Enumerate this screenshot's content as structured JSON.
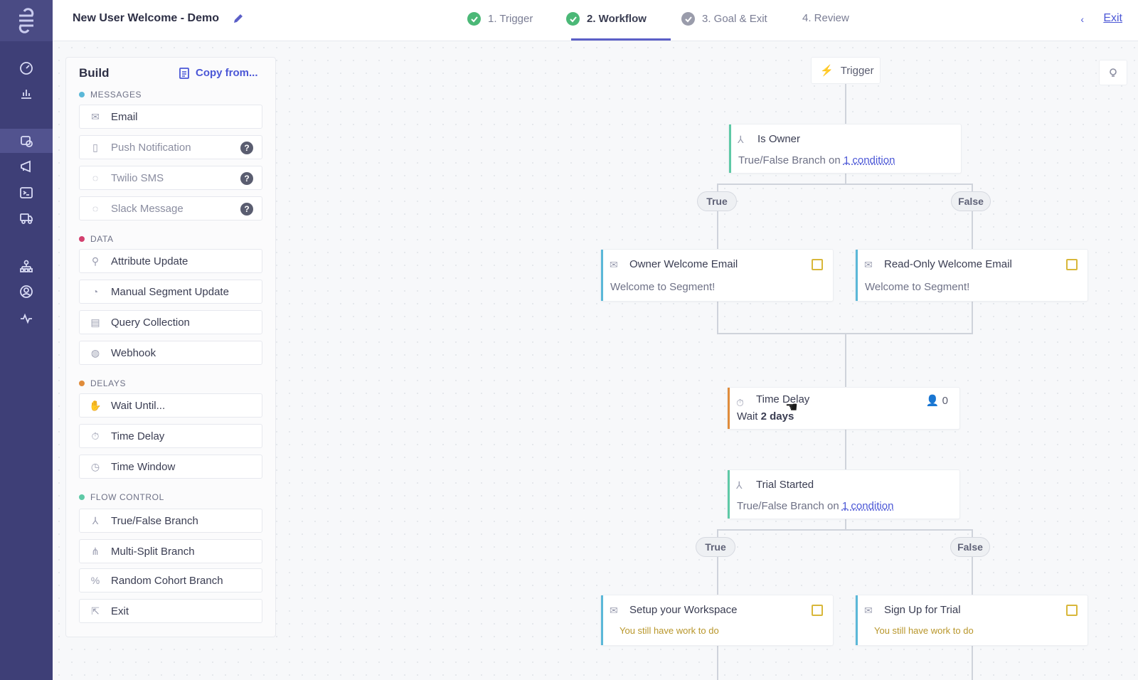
{
  "app": {
    "title": "New User Welcome - Demo",
    "accent_color": "#5b5fc7",
    "rail_color": "#3e3f77"
  },
  "steps": [
    {
      "label": "1. Trigger",
      "status": "done"
    },
    {
      "label": "2. Workflow",
      "status": "active"
    },
    {
      "label": "3. Goal & Exit",
      "status": "done"
    },
    {
      "label": "4. Review",
      "status": "pending"
    }
  ],
  "exit_label": "Exit",
  "build_panel": {
    "title": "Build",
    "copy_from": "Copy from...",
    "sections": {
      "messages": {
        "label": "MESSAGES",
        "color": "#5bb8d8",
        "items": [
          {
            "label": "Email",
            "icon": "envelope-icon"
          },
          {
            "label": "Push Notification",
            "icon": "phone-icon",
            "help": "?"
          },
          {
            "label": "Twilio SMS",
            "icon": "sms-icon",
            "help": "?"
          },
          {
            "label": "Slack Message",
            "icon": "chat-icon",
            "help": "?"
          }
        ]
      },
      "data": {
        "label": "DATA",
        "color": "#d33f6e",
        "items": [
          {
            "label": "Attribute Update",
            "icon": "user-edit-icon"
          },
          {
            "label": "Manual Segment Update",
            "icon": "gauge-icon"
          },
          {
            "label": "Query Collection",
            "icon": "table-icon"
          },
          {
            "label": "Webhook",
            "icon": "globe-icon"
          }
        ]
      },
      "delays": {
        "label": "DELAYS",
        "color": "#e08c3b",
        "items": [
          {
            "label": "Wait Until...",
            "icon": "hand-icon"
          },
          {
            "label": "Time Delay",
            "icon": "stopwatch-icon"
          },
          {
            "label": "Time Window",
            "icon": "clock-icon"
          }
        ]
      },
      "flow_control": {
        "label": "FLOW CONTROL",
        "color": "#5ec9a6",
        "items": [
          {
            "label": "True/False Branch",
            "icon": "branch-icon"
          },
          {
            "label": "Multi-Split Branch",
            "icon": "multi-branch-icon"
          },
          {
            "label": "Random Cohort Branch",
            "icon": "percent-icon"
          },
          {
            "label": "Exit",
            "icon": "exit-icon"
          }
        ]
      }
    }
  },
  "flow": {
    "trigger": "Trigger",
    "is_owner": {
      "title": "Is Owner",
      "sub_prefix": "True/False Branch on",
      "sub_link": "1 condition"
    },
    "branch1_true": "True",
    "branch1_false": "False",
    "owner_email": {
      "title": "Owner Welcome Email",
      "sub": "Welcome to Segment!"
    },
    "readonly_email": {
      "title": "Read-Only Welcome Email",
      "sub": "Welcome to Segment!"
    },
    "time_delay": {
      "title": "Time Delay",
      "sub_prefix": "Wait",
      "sub_value": "2 days",
      "count": "0"
    },
    "trial_started": {
      "title": "Trial Started",
      "sub_prefix": "True/False Branch on",
      "sub_link": "1 condition"
    },
    "branch2_true": "True",
    "branch2_false": "False",
    "setup_workspace": {
      "title": "Setup your Workspace",
      "sub": "You still have work to do"
    },
    "sign_up_trial": {
      "title": "Sign Up for Trial",
      "sub": "You still have work to do"
    }
  }
}
